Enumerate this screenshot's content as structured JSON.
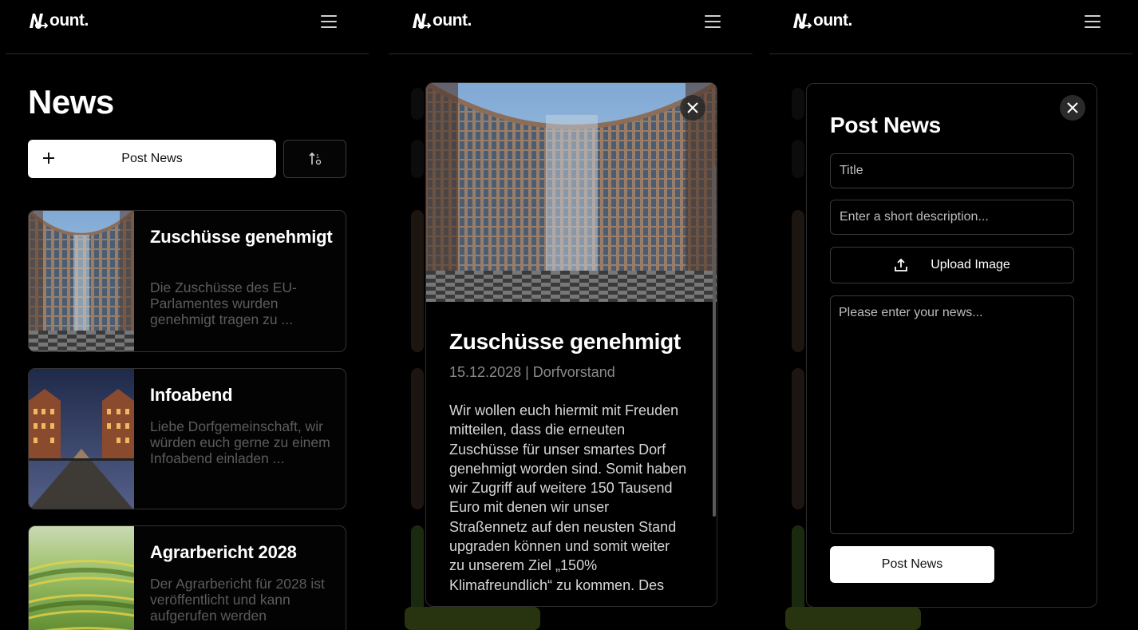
{
  "app": {
    "logo_text": "ount.",
    "logo_mark": "n-with-arrow-logo",
    "menu_icon": "hamburger-menu-icon"
  },
  "news_list": {
    "title": "News",
    "post_button_label": "Post News",
    "post_button_icon": "plus-icon",
    "sort_icon": "sort-arrows-icon",
    "items": [
      {
        "title": "Zuschüsse genehmigt",
        "description": "Die Zuschüsse des EU-Parlamentes wurden genehmigt tragen zu ...",
        "image": "parliament-building"
      },
      {
        "title": "Infoabend",
        "description": "Liebe Dorfgemeinschaft, wir würden euch gerne zu einem Infoabend einladen ...",
        "image": "speicherstadt-bridge"
      },
      {
        "title": "Agrarbericht 2028",
        "description": "Der Agrarbericht für 2028 ist veröffentlicht und kann aufgerufen werden",
        "image": "rice-terraces"
      }
    ]
  },
  "news_detail": {
    "title": "Zuschüsse genehmigt",
    "meta": "15.12.2028 | Dorfvorstand",
    "body": "Wir wollen euch hiermit mit Freuden mitteilen, dass die erneuten Zuschüsse für unser smartes Dorf genehmigt worden sind. Somit haben wir Zugriff auf weitere 150 Tausend Euro mit denen wir unser Straßennetz auf den neusten Stand upgraden können und somit weiter zu unserem Ziel „150% Klimafreundlich“ zu kommen. Des",
    "close_icon": "close-icon"
  },
  "post_form": {
    "title": "Post News",
    "title_placeholder": "Title",
    "description_placeholder": "Enter a short description...",
    "upload_label": "Upload Image",
    "upload_icon": "upload-icon",
    "news_placeholder": "Please enter your news...",
    "submit_label": "Post News",
    "close_icon": "close-icon"
  },
  "colors": {
    "background": "#000000",
    "border": "#333333",
    "primary_button": "#ffffff",
    "muted_text": "#5c5c5c",
    "meta_text": "#8a8a8a"
  }
}
